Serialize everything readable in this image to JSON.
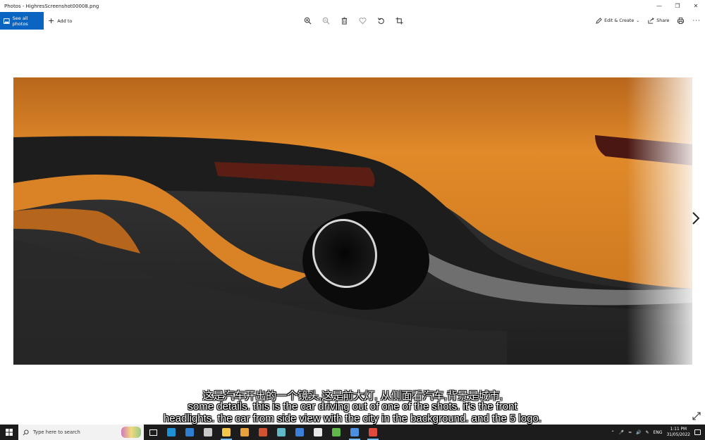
{
  "window": {
    "title": "Photos - HighresScreenshot00008.png",
    "minimize_icon": "minimize-icon",
    "maximize_icon": "maximize-icon",
    "close_icon": "close-icon"
  },
  "toolbar": {
    "see_all_label": "See all photos",
    "add_to_label": "Add to",
    "center_icons": [
      "zoom-in-icon",
      "zoom-out-icon",
      "delete-icon",
      "favorite-icon",
      "rotate-icon",
      "crop-icon"
    ],
    "edit_create_label": "Edit & Create",
    "share_label": "Share"
  },
  "subtitles": {
    "line_cn": "这是汽车开出的一个镜头,这是前大灯, 从侧面看汽车,背景是城市,",
    "line_en_1": "some details. this is the car driving out of one of the shots. it's the front",
    "line_en_2": "headlights. the car from side view with the city in the background. and the 5 logo."
  },
  "taskbar": {
    "search_placeholder": "Type here to search",
    "apps": [
      {
        "name": "edge",
        "color": "#1e90d6"
      },
      {
        "name": "mail",
        "color": "#2f7fd0"
      },
      {
        "name": "store",
        "color": "#c9c9c9"
      },
      {
        "name": "explorer",
        "color": "#f2c64a"
      },
      {
        "name": "chrome",
        "color": "#e9a23b"
      },
      {
        "name": "powerpoint",
        "color": "#d35230"
      },
      {
        "name": "app-teal",
        "color": "#5fb7c8"
      },
      {
        "name": "app-blue",
        "color": "#3c7fd9"
      },
      {
        "name": "unreal",
        "color": "#e8e8e8"
      },
      {
        "name": "camtasia",
        "color": "#60b94a"
      },
      {
        "name": "photos",
        "color": "#4a8fe0"
      },
      {
        "name": "app-red",
        "color": "#e04a3a"
      }
    ],
    "language": "ENG",
    "time": "1:11 PM",
    "date": "31/05/2022"
  }
}
